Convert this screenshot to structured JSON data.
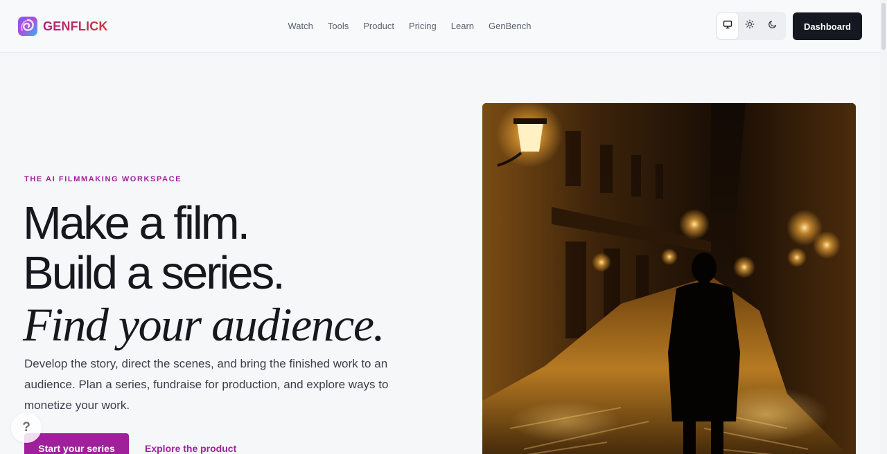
{
  "brand": {
    "name": "GENFLICK",
    "logo_icon": "swirl-logo-icon"
  },
  "nav": {
    "items": [
      {
        "label": "Watch"
      },
      {
        "label": "Tools"
      },
      {
        "label": "Product"
      },
      {
        "label": "Pricing"
      },
      {
        "label": "Learn"
      },
      {
        "label": "GenBench"
      }
    ]
  },
  "theme": {
    "options": [
      {
        "icon": "monitor-icon",
        "selected": true
      },
      {
        "icon": "sun-icon",
        "selected": false
      },
      {
        "icon": "moon-icon",
        "selected": false
      }
    ]
  },
  "header": {
    "dashboard_label": "Dashboard"
  },
  "hero": {
    "eyebrow": "THE AI FILMMAKING WORKSPACE",
    "headline_1": "Make a film.",
    "headline_2": "Build a series.",
    "headline_3": "Find your audience.",
    "body": "Develop the story, direct the scenes, and bring the finished work to an audience. Plan a series, fundraise for production, and explore ways to monetize your work.",
    "cta_primary": "Start your series",
    "cta_secondary": "Explore the product"
  },
  "help": {
    "label": "?"
  },
  "colors": {
    "accent": "#a0209b",
    "dark": "#151820",
    "background": "#f6f7f9"
  }
}
